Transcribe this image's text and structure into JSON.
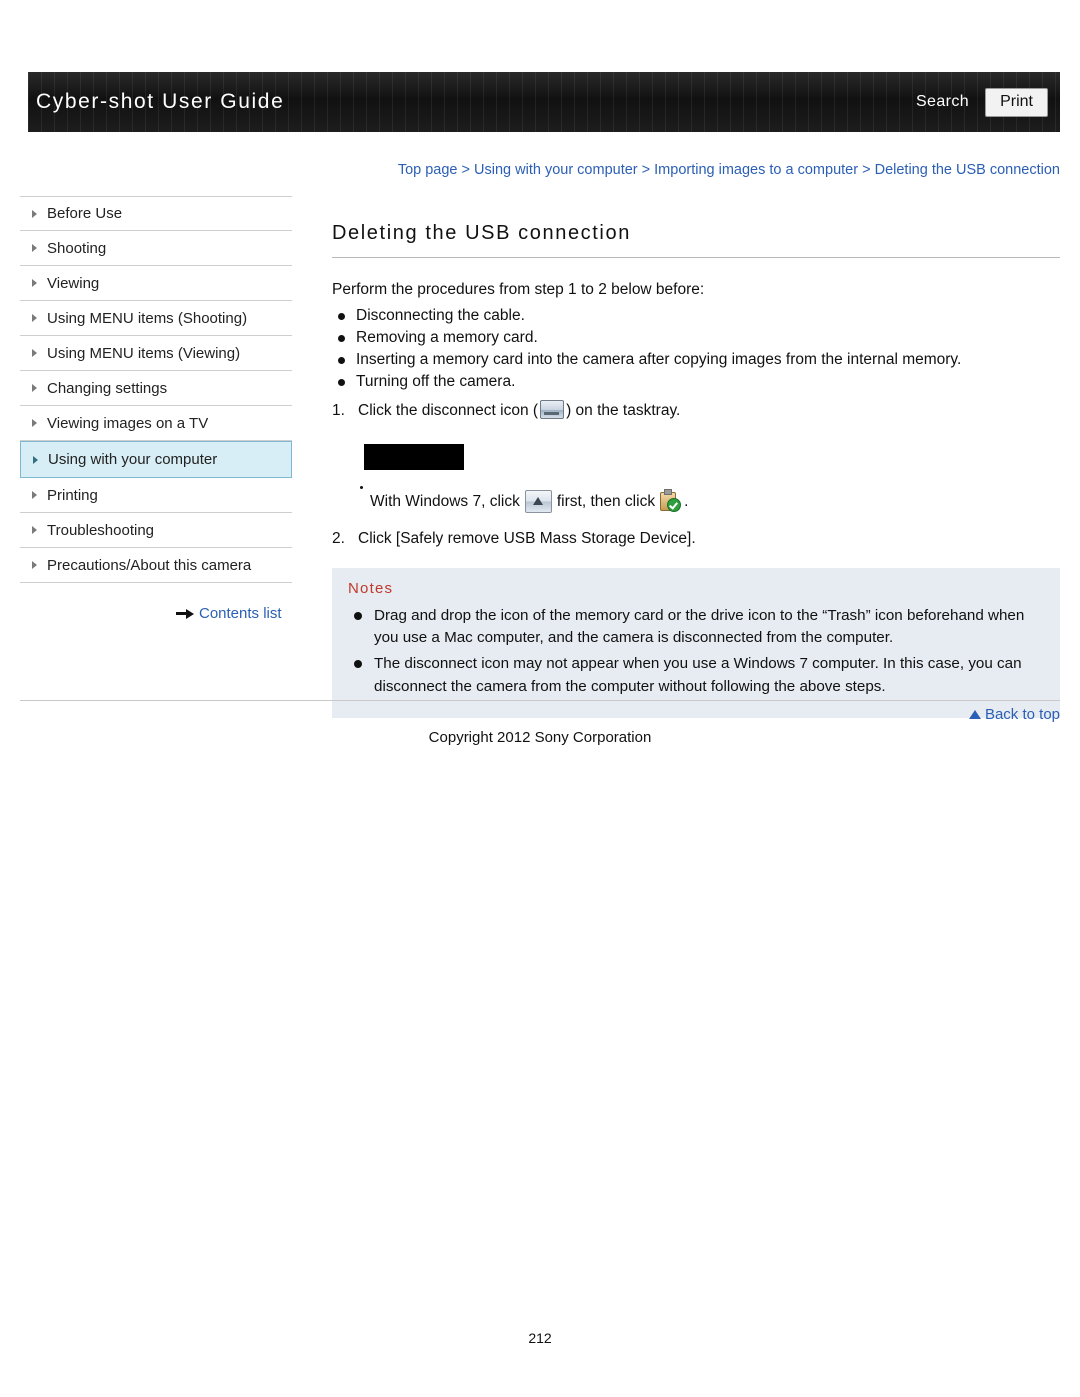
{
  "header": {
    "title": "Cyber-shot User Guide",
    "search_label": "Search",
    "print_label": "Print"
  },
  "breadcrumb": {
    "items": [
      "Top page",
      "Using with your computer",
      "Importing images to a computer",
      "Deleting the USB connection"
    ],
    "separator": ">"
  },
  "sidebar": {
    "items": [
      {
        "label": "Before Use"
      },
      {
        "label": "Shooting"
      },
      {
        "label": "Viewing"
      },
      {
        "label": "Using MENU items (Shooting)"
      },
      {
        "label": "Using MENU items (Viewing)"
      },
      {
        "label": "Changing settings"
      },
      {
        "label": "Viewing images on a TV"
      },
      {
        "label": "Using with your computer"
      },
      {
        "label": "Printing"
      },
      {
        "label": "Troubleshooting"
      },
      {
        "label": "Precautions/About this camera"
      }
    ],
    "active_index": 7,
    "contents_list_label": "Contents list"
  },
  "main": {
    "title": "Deleting the USB connection",
    "intro": "Perform the procedures from step 1 to 2 below before:",
    "bullets": [
      "Disconnecting the cable.",
      "Removing a memory card.",
      "Inserting a memory card into the camera after copying images from the internal memory.",
      "Turning off the camera."
    ],
    "step1_num": "1.",
    "step1_before": "Click the disconnect icon (",
    "step1_after": ") on the tasktray.",
    "win7_before": "With Windows 7, click",
    "win7_mid": "first, then click",
    "win7_after": ".",
    "step2_num": "2.",
    "step2_text": "Click [Safely remove USB Mass Storage Device]."
  },
  "notes": {
    "title": "Notes",
    "items": [
      "Drag and drop the icon of the memory card or the drive icon to the “Trash” icon beforehand when you use a Mac computer, and the camera is disconnected from the computer.",
      "The disconnect icon may not appear when you use a Windows 7 computer. In this case, you can disconnect the camera from the computer without following the above steps."
    ]
  },
  "footer": {
    "back_to_top": "Back to top",
    "copyright": "Copyright 2012 Sony Corporation",
    "page_number": "212"
  }
}
